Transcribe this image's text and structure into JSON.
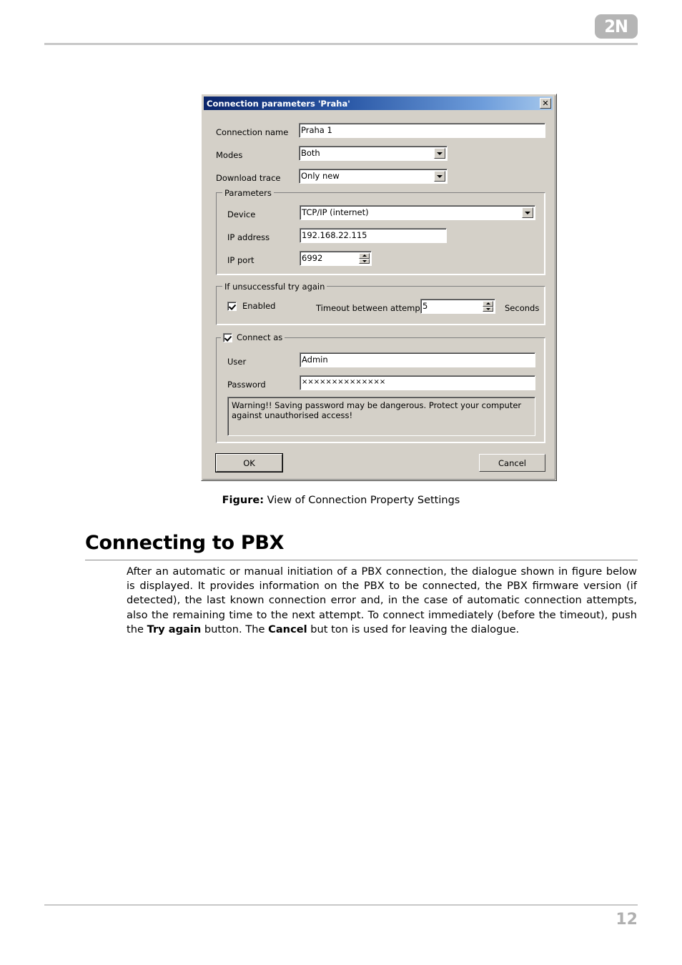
{
  "page": {
    "number": "12",
    "logo_text": "2N"
  },
  "figure": {
    "label": "Figure:",
    "caption": " View of Connection Property Settings"
  },
  "section": {
    "heading": "Connecting to PBX",
    "paragraph_part_1": "After an automatic or manual initiation of a PBX connection, the dialogue shown in figure below is displayed. It provides information on the PBX to be connected, the PBX firmware version (if detected), the last known connection error and, in the case of automatic connection attempts, also the remaining time to the next attempt. To connect immediately (before the timeout), push the ",
    "paragraph_bold_1": "Try again",
    "paragraph_part_2": " button. The ",
    "paragraph_bold_2": "Cancel",
    "paragraph_part_3": " but ton is used for leaving the dialogue."
  },
  "dialog": {
    "title": "Connection parameters 'Praha'",
    "close_label": "✕",
    "fields": {
      "connection_name_label": "Connection name",
      "connection_name_value": "Praha 1",
      "modes_label": "Modes",
      "modes_value": "Both",
      "download_trace_label": "Download trace",
      "download_trace_value": "Only new"
    },
    "parameters_group": {
      "title": "Parameters",
      "device_label": "Device",
      "device_value": "TCP/IP (internet)",
      "ip_address_label": "IP address",
      "ip_address_value": "192.168.22.115",
      "ip_port_label": "IP port",
      "ip_port_value": "6992"
    },
    "retry_group": {
      "title": "If unsuccessful try again",
      "enabled_label": "Enabled",
      "enabled_checked": true,
      "timeout_label": "Timeout between attemp",
      "timeout_value": "5",
      "seconds_label": "Seconds"
    },
    "connect_as_group": {
      "title": "Connect as",
      "checked": true,
      "user_label": "User",
      "user_value": "Admin",
      "password_label": "Password",
      "password_value": "××××××××××××××",
      "warning_text": "Warning!! Saving password may be dangerous. Protect your computer against unauthorised access!"
    },
    "buttons": {
      "ok": "OK",
      "cancel": "Cancel"
    },
    "colors": {
      "title_gradient_start": "#0a246a",
      "title_gradient_end": "#a6c8ec",
      "face": "#d4d0c8",
      "field_bg": "#ffffff"
    }
  }
}
